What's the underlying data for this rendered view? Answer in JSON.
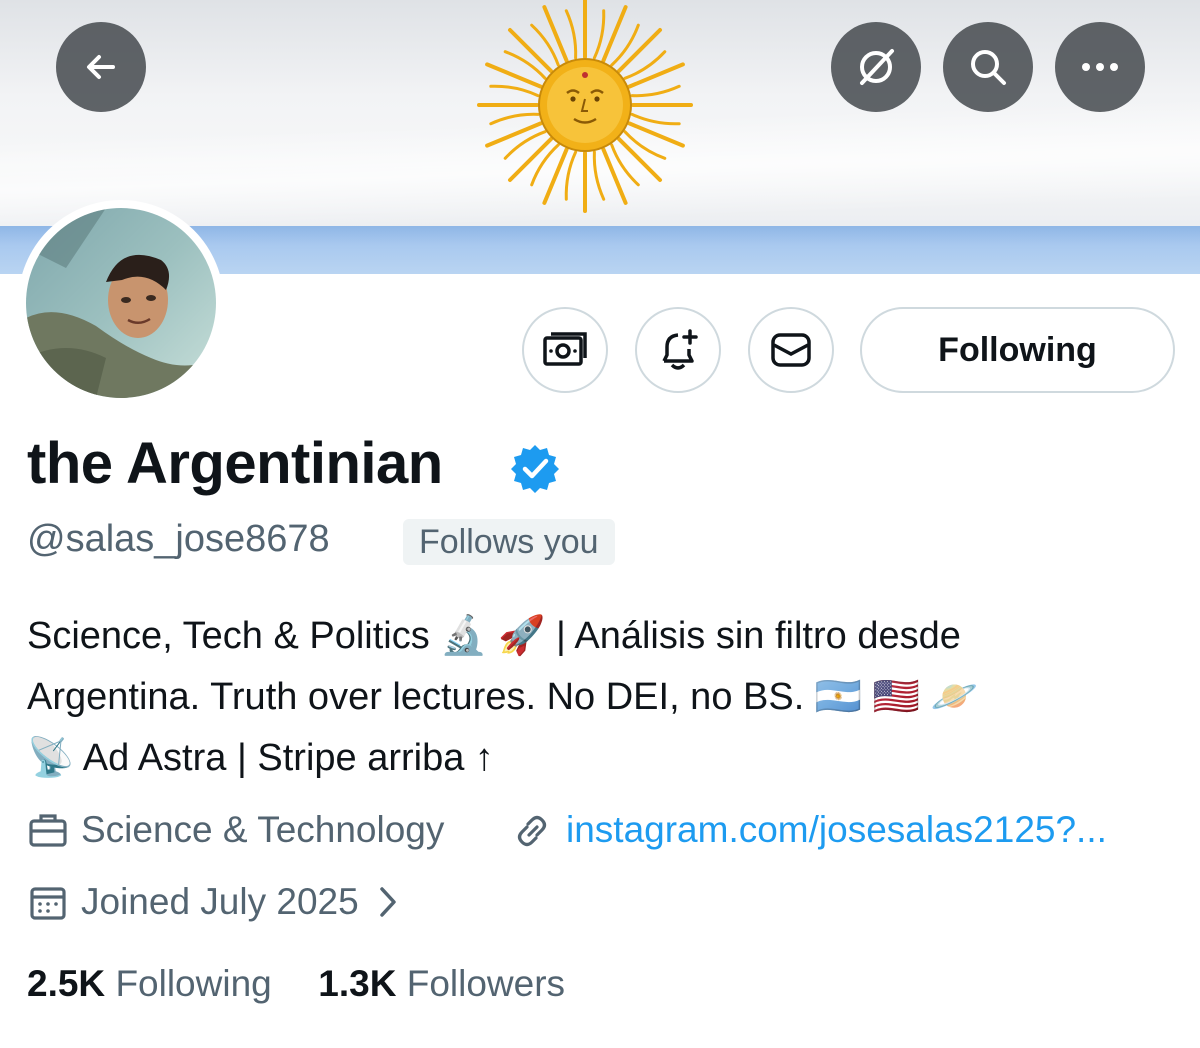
{
  "header": {
    "back_icon": "arrow-left-icon",
    "grok_icon": "grok-icon",
    "search_icon": "search-icon",
    "more_icon": "more-horizontal-icon"
  },
  "banner": {
    "description_icon": "argentina-flag-sun"
  },
  "actions": {
    "tip_icon": "money-icon",
    "notify_icon": "bell-plus-icon",
    "message_icon": "envelope-icon",
    "following_label": "Following"
  },
  "profile": {
    "display_name": "the Argentinian",
    "verified": true,
    "handle": "@salas_jose8678",
    "follows_you": "Follows you",
    "bio_lines": [
      "Science, Tech & Politics 🔬 🚀 | Análisis sin filtro desde",
      "Argentina. Truth over lectures. No DEI, no BS. 🇦🇷 🇺🇸 🪐",
      "📡 Ad Astra | Stripe arriba ↑"
    ],
    "category": "Science & Technology",
    "link": "instagram.com/josesalas2125?...",
    "joined": "Joined July 2025"
  },
  "stats": {
    "following_count": "2.5K",
    "following_label": "Following",
    "followers_count": "1.3K",
    "followers_label": "Followers"
  },
  "colors": {
    "accent_blue": "#1d9bf0",
    "text_primary": "#0f1419",
    "text_secondary": "#536471",
    "flag_blue": "#a9c9ef",
    "sun_gold": "#f2b118"
  }
}
